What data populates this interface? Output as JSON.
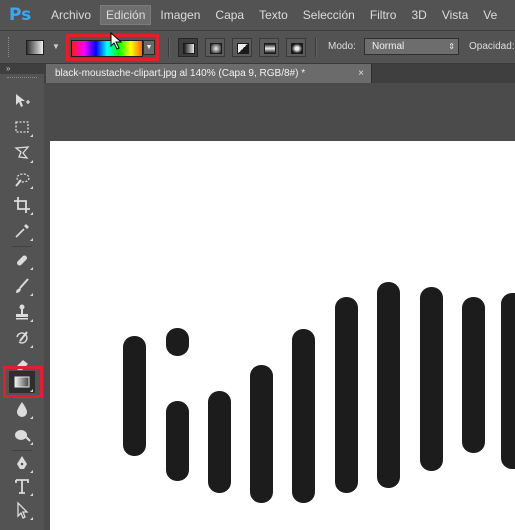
{
  "app": {
    "logo": "Ps"
  },
  "menu": {
    "items": [
      {
        "label": "Archivo"
      },
      {
        "label": "Edición",
        "active": true
      },
      {
        "label": "Imagen"
      },
      {
        "label": "Capa"
      },
      {
        "label": "Texto"
      },
      {
        "label": "Selección"
      },
      {
        "label": "Filtro"
      },
      {
        "label": "3D"
      },
      {
        "label": "Vista"
      },
      {
        "label": "Ve"
      }
    ]
  },
  "options_bar": {
    "gradient_colors": [
      "#ff1a1a",
      "#ff00ff",
      "#0000ff",
      "#00ffff",
      "#00ff00",
      "#ffff00",
      "#ff6a00"
    ],
    "gradient_types": [
      "linear-gradient-icon",
      "radial-gradient-icon",
      "angle-gradient-icon",
      "reflected-gradient-icon",
      "diamond-gradient-icon"
    ],
    "modo_label": "Modo:",
    "modo_value": "Normal",
    "opacidad_label": "Opacidad:"
  },
  "toolbox": {
    "collapse_label": "»",
    "tools": [
      "move-tool-icon",
      "marquee-tool-icon",
      "lasso-tool-icon",
      "quick-selection-tool-icon",
      "crop-tool-icon",
      "eyedropper-tool-icon",
      "healing-brush-tool-icon",
      "brush-tool-icon",
      "clone-stamp-tool-icon",
      "history-brush-tool-icon",
      "eraser-tool-icon",
      "gradient-tool-icon",
      "blur-tool-icon",
      "dodge-tool-icon",
      "pen-tool-icon",
      "type-tool-icon",
      "path-selection-tool-icon"
    ],
    "active_tool": "gradient-tool-icon"
  },
  "document": {
    "tab_title": "black-moustache-clipart.jpg al 140% (Capa 9, RGB/8#) *",
    "close_glyph": "×"
  },
  "colors": {
    "highlight": "#e0202d",
    "ps_blue": "#3fa6f0",
    "artwork": "#1c1c1c"
  }
}
